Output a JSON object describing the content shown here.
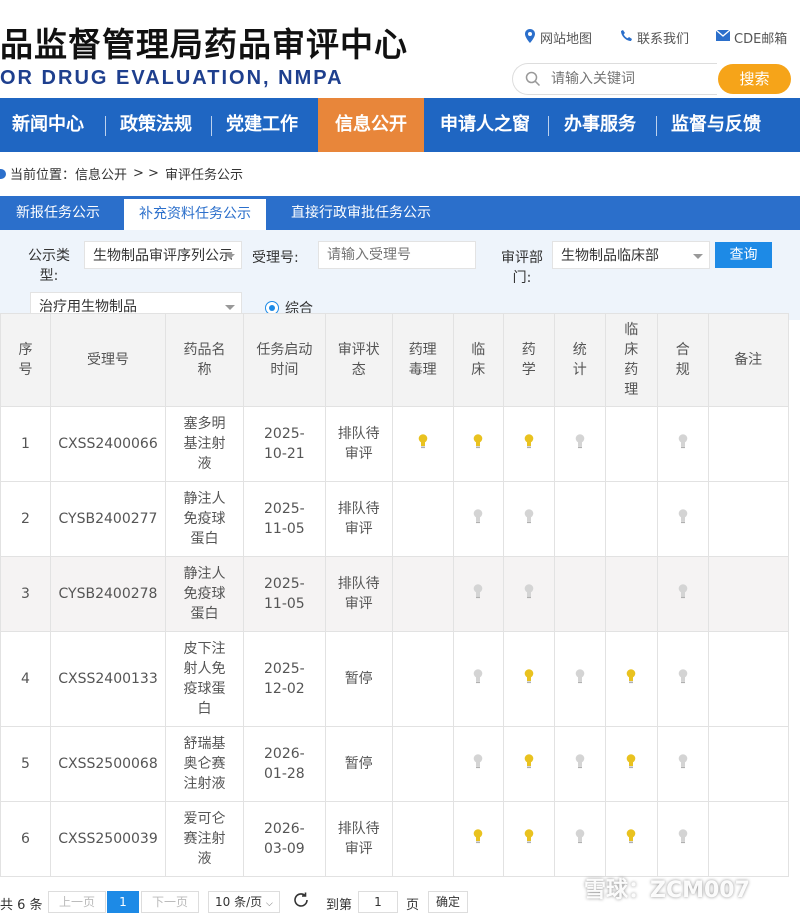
{
  "header": {
    "title_cn": "品监督管理局药品审评中心",
    "title_en": "OR DRUG EVALUATION, NMPA",
    "links": {
      "sitemap": "网站地图",
      "contact": "联系我们",
      "mail": "CDE邮箱"
    },
    "search_placeholder": "请输入关键词",
    "search_button": "搜索"
  },
  "nav": {
    "items": [
      "新闻中心",
      "政策法规",
      "党建工作",
      "信息公开",
      "申请人之窗",
      "办事服务",
      "监督与反馈"
    ],
    "active_index": 3
  },
  "breadcrumb": {
    "prefix": "当前位置：信息公开",
    "sep": "> >",
    "current": "审评任务公示"
  },
  "tabs": [
    "新报任务公示",
    "补充资料任务公示",
    "直接行政审批任务公示"
  ],
  "filters": {
    "type_label": "公示类型:",
    "type_value": "生物制品审评序列公示",
    "accept_label": "受理号:",
    "accept_placeholder": "请输入受理号",
    "dept_label": "审评部门:",
    "dept_value": "生物制品临床部",
    "query_button": "查询",
    "category_value": "治疗用生物制品",
    "radio_label": "综合"
  },
  "table": {
    "headers": [
      "序号",
      "受理号",
      "药品名称",
      "任务启动时间",
      "审评状态",
      "药理毒理",
      "临床",
      "药学",
      "统计",
      "临床药理",
      "合规",
      "备注"
    ],
    "rows": [
      {
        "no": "1",
        "id": "CXSS2400066",
        "name": "塞多明基注射液",
        "date": "2025-10-21",
        "status": "排队待审评",
        "bulbs": [
          "on",
          "on",
          "on",
          "off",
          "",
          "off"
        ]
      },
      {
        "no": "2",
        "id": "CYSB2400277",
        "name": "静注人免疫球蛋白",
        "date": "2025-11-05",
        "status": "排队待审评",
        "bulbs": [
          "",
          "off",
          "off",
          "",
          "",
          "off"
        ]
      },
      {
        "no": "3",
        "id": "CYSB2400278",
        "name": "静注人免疫球蛋白",
        "date": "2025-11-05",
        "status": "排队待审评",
        "bulbs": [
          "",
          "off",
          "off",
          "",
          "",
          "off"
        ]
      },
      {
        "no": "4",
        "id": "CXSS2400133",
        "name": "皮下注射人免疫球蛋白",
        "date": "2025-12-02",
        "status": "暂停",
        "bulbs": [
          "",
          "off",
          "on",
          "off",
          "on",
          "off"
        ]
      },
      {
        "no": "5",
        "id": "CXSS2500068",
        "name": "舒瑞基奥仑赛注射液",
        "date": "2026-01-28",
        "status": "暂停",
        "bulbs": [
          "",
          "off",
          "on",
          "off",
          "on",
          "off"
        ]
      },
      {
        "no": "6",
        "id": "CXSS2500039",
        "name": "爱可仑赛注射液",
        "date": "2026-03-09",
        "status": "排队待审评",
        "bulbs": [
          "",
          "on",
          "on",
          "off",
          "on",
          "off"
        ]
      }
    ]
  },
  "pager": {
    "total": "共 6 条",
    "prev": "上一页",
    "page": "1",
    "next": "下一页",
    "size": "10 条/页",
    "goto": "到第",
    "goto_value": "1",
    "page_unit": "页",
    "confirm": "确定"
  },
  "watermark": "雪球：ZCM007",
  "colors": {
    "nav": "#1f66c2",
    "nav_active": "#e8863a",
    "search_btn": "#f6a419",
    "bulb_on": "#e9c21f",
    "bulb_off": "#d4d4d4"
  }
}
